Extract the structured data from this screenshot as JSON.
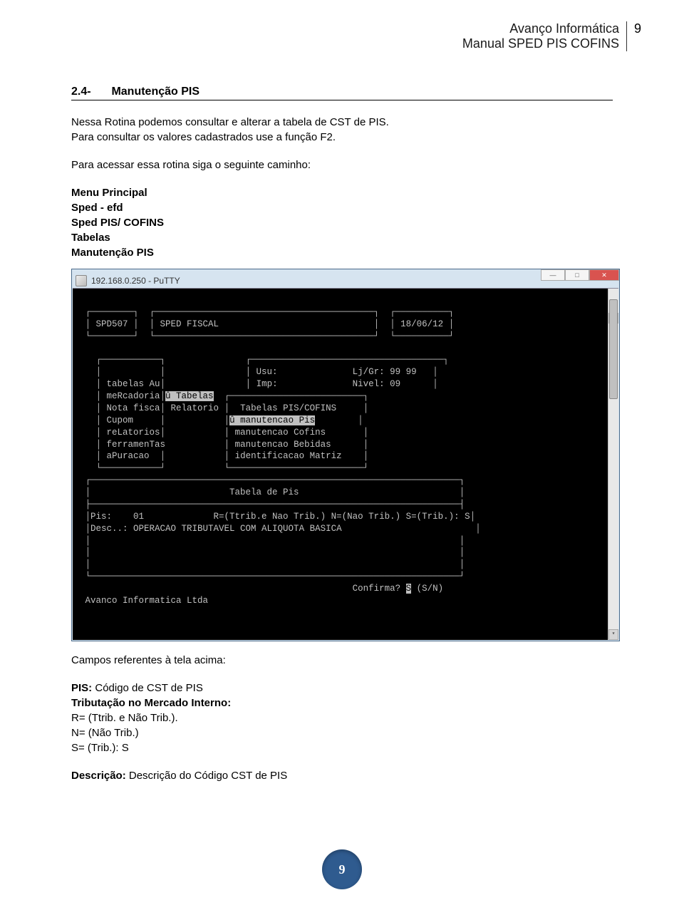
{
  "header": {
    "line1": "Avanço Informática",
    "line2": "Manual SPED PIS COFINS",
    "pagenum_top": "9"
  },
  "section": {
    "num": "2.4-",
    "title": "Manutenção PIS"
  },
  "paras": {
    "p1a": "Nessa Rotina podemos consultar e alterar a tabela de CST de PIS.",
    "p1b": "Para consultar os valores cadastrados use a função F2.",
    "p2": "Para acessar essa rotina siga o seguinte caminho:"
  },
  "menu": {
    "m1": "Menu Principal",
    "m2": "Sped - efd",
    "m3": "Sped PIS/ COFINS",
    "m4": "Tabelas",
    "m5": "Manutenção PIS"
  },
  "putty": {
    "title": "192.168.0.250 - PuTTY"
  },
  "term": {
    "hdr_left": "SPD507",
    "hdr_mid": "SPED FISCAL",
    "hdr_right": "18/06/12",
    "usu": "Usu:",
    "imp": "Imp:",
    "ljgr": "Lj/Gr: 99 99",
    "nivel": "Nivel: 09",
    "side1": "tabelas Au",
    "side2": "meRcadoria",
    "side3": "Nota fisca",
    "side4": "Cupom",
    "side5": "reLatorios",
    "side6": "ferramenTas",
    "side7": "aPuracao",
    "mid1": "û Tabelas",
    "mid2": "Relatorio",
    "submenu_title": "Tabelas PIS/COFINS",
    "sub1": "û manutencao Pis",
    "sub2": "manutencao Cofins",
    "sub3": "manutencao Bebidas",
    "sub4": "identificacao Matriz",
    "panel_title": "Tabela de Pis",
    "pis_line": "Pis:    01             R=(Ttrib.e Nao Trib.) N=(Nao Trib.) S=(Trib.): S",
    "desc_line": "Desc..: OPERACAO TRIBUTAVEL COM ALIQUOTA BASICA",
    "confirm": "Confirma? ",
    "confirm_val": "S",
    "confirm_opts": " (S/N)",
    "footer": "Avanco Informatica Ltda"
  },
  "below": {
    "title": "Campos referentes à tela acima:",
    "pis_lbl": "PIS:",
    "pis_txt": " Código de CST de PIS",
    "trib_lbl": "Tributação no Mercado Interno:",
    "r": "R= (Ttrib. e Não Trib.).",
    "n": "N= (Não Trib.)",
    "s": "S= (Trib.): S",
    "desc_lbl": "Descrição:",
    "desc_txt": " Descrição do Código CST de PIS"
  },
  "page_bubble": "9"
}
